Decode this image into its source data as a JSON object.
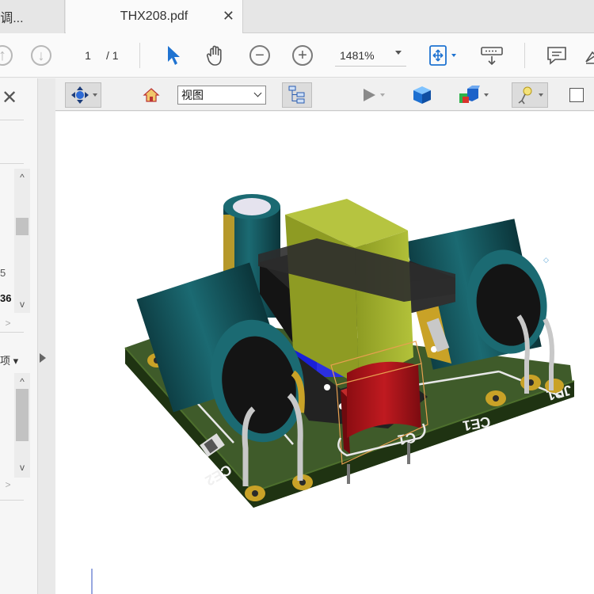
{
  "tabs": {
    "previous_label": "rd调...",
    "active_label": "THX208.pdf",
    "close_symbol": "✕"
  },
  "toolbar": {
    "page_current": "1",
    "page_total": "/ 1",
    "zoom_value": "1481%",
    "icons": [
      "page-up-icon",
      "page-down-icon",
      "select-cursor-icon",
      "hand-tool-icon",
      "zoom-out-icon",
      "zoom-in-icon",
      "fit-page-icon",
      "read-mode-icon",
      "comment-icon",
      "sign-icon"
    ]
  },
  "left_panel": {
    "close_symbol": "✕",
    "text_5": "5",
    "text_36": "36",
    "options_label": "项",
    "chevron_up": "^",
    "chevron_down": "v",
    "chevron_right": ">"
  },
  "toolbar_3d": {
    "view_select_value": "视图",
    "icons": [
      "rotate-tool-icon",
      "home-view-icon",
      "model-tree-icon",
      "play-animation-icon",
      "render-mode-icon",
      "lighting-icon",
      "background-color-icon",
      "checkbox-icon"
    ]
  },
  "model": {
    "silk_labels": [
      "CE2",
      "CE1",
      "C1",
      "JP1"
    ],
    "colors": {
      "pcb": "#2f4a1e",
      "capacitor_body": "#17575e",
      "transformer": "#9aa62a",
      "film_capacitor": "#b5141a",
      "bobbin": "#2a2a2a",
      "gold_pad": "#c9a227",
      "blue_core": "#1a1fd0"
    }
  }
}
